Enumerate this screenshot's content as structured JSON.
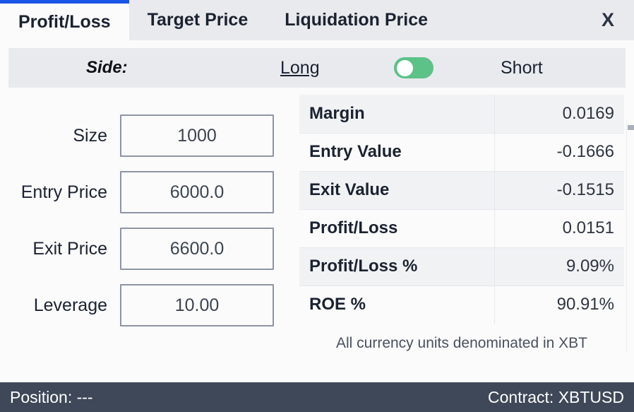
{
  "tabs": [
    {
      "label": "Profit/Loss",
      "active": true
    },
    {
      "label": "Target Price",
      "active": false
    },
    {
      "label": "Liquidation Price",
      "active": false
    }
  ],
  "close_label": "X",
  "side": {
    "label": "Side:",
    "long_label": "Long",
    "short_label": "Short",
    "selected": "Long",
    "toggle_color": "#5cc287",
    "knob_position": "left"
  },
  "form": {
    "fields": [
      {
        "label": "Size",
        "value": "1000"
      },
      {
        "label": "Entry Price",
        "value": "6000.0"
      },
      {
        "label": "Exit Price",
        "value": "6600.0"
      },
      {
        "label": "Leverage",
        "value": "10.00"
      }
    ]
  },
  "results": {
    "rows": [
      {
        "key": "Margin",
        "value": "0.0169"
      },
      {
        "key": "Entry Value",
        "value": "-0.1666"
      },
      {
        "key": "Exit Value",
        "value": "-0.1515"
      },
      {
        "key": "Profit/Loss",
        "value": "0.0151"
      },
      {
        "key": "Profit/Loss %",
        "value": "9.09%"
      },
      {
        "key": "ROE %",
        "value": "90.91%"
      }
    ],
    "footnote": "All currency units denominated in XBT"
  },
  "status": {
    "position": "Position: ---",
    "contract": "Contract: XBTUSD"
  },
  "theme": {
    "accent": "#1a56e8",
    "toggle_green": "#5cc287",
    "status_bg": "#3e4858"
  }
}
